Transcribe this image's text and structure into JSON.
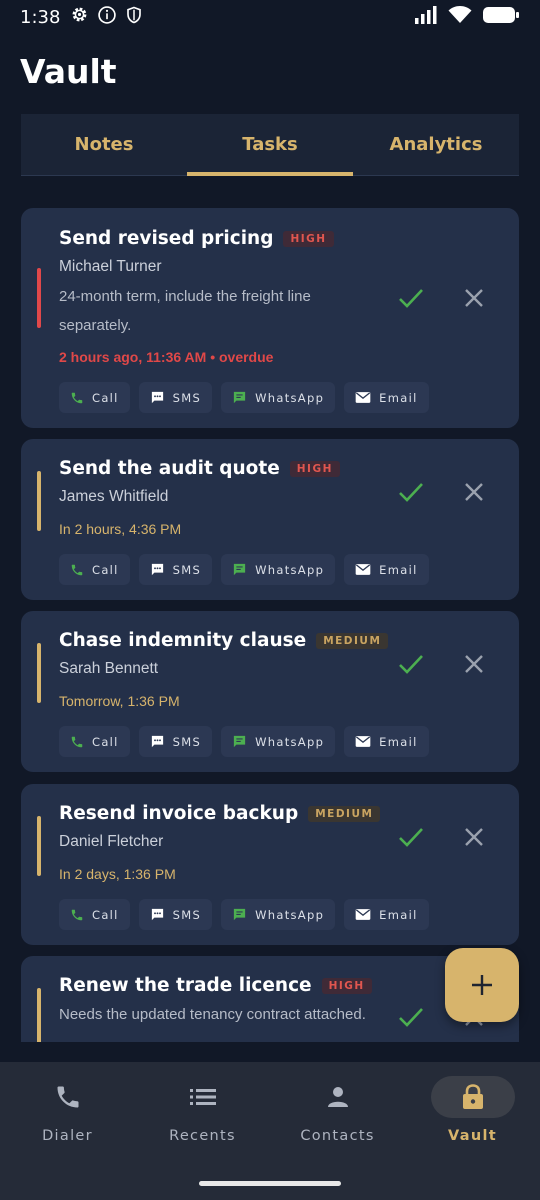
{
  "status_bar": {
    "time": "1:38"
  },
  "app": {
    "title": "Vault"
  },
  "tabs": [
    {
      "label": "Notes"
    },
    {
      "label": "Tasks"
    },
    {
      "label": "Analytics"
    }
  ],
  "active_tab": "Tasks",
  "action_labels": {
    "call": "Call",
    "sms": "SMS",
    "whatsapp": "WhatsApp",
    "email": "Email"
  },
  "tasks": [
    {
      "title": "Send revised pricing",
      "priority": "HIGH",
      "contact": "Michael Turner",
      "note": "24-month term, include the freight line separately.",
      "due": "2 hours ago, 11:36 AM • overdue",
      "accent": "#e0484a"
    },
    {
      "title": "Send the audit quote",
      "priority": "HIGH",
      "contact": "James Whitfield",
      "due": "In 2 hours, 4:36 PM",
      "accent": "#d7b46c"
    },
    {
      "title": "Chase indemnity clause",
      "priority": "MEDIUM",
      "contact": "Sarah Bennett",
      "due": "Tomorrow, 1:36 PM",
      "accent": "#d7b46c"
    },
    {
      "title": "Resend invoice backup",
      "priority": "MEDIUM",
      "contact": "Daniel Fletcher",
      "due": "In 2 days, 1:36 PM",
      "accent": "#d7b46c"
    },
    {
      "title": "Renew the trade licence",
      "priority": "HIGH",
      "note": "Needs the updated tenancy contract attached.",
      "accent": "#d7b46c"
    }
  ],
  "fab": {
    "icon": "plus-icon"
  },
  "bottom_nav": [
    {
      "label": "Dialer",
      "icon": "phone-icon"
    },
    {
      "label": "Recents",
      "icon": "list-icon"
    },
    {
      "label": "Contacts",
      "icon": "person-icon"
    },
    {
      "label": "Vault",
      "icon": "lock-icon"
    }
  ],
  "colors": {
    "background": "#111827",
    "card": "#243049",
    "accent_gold": "#d7b46c",
    "overdue_red": "#e04848",
    "check_green": "#4caf50"
  }
}
